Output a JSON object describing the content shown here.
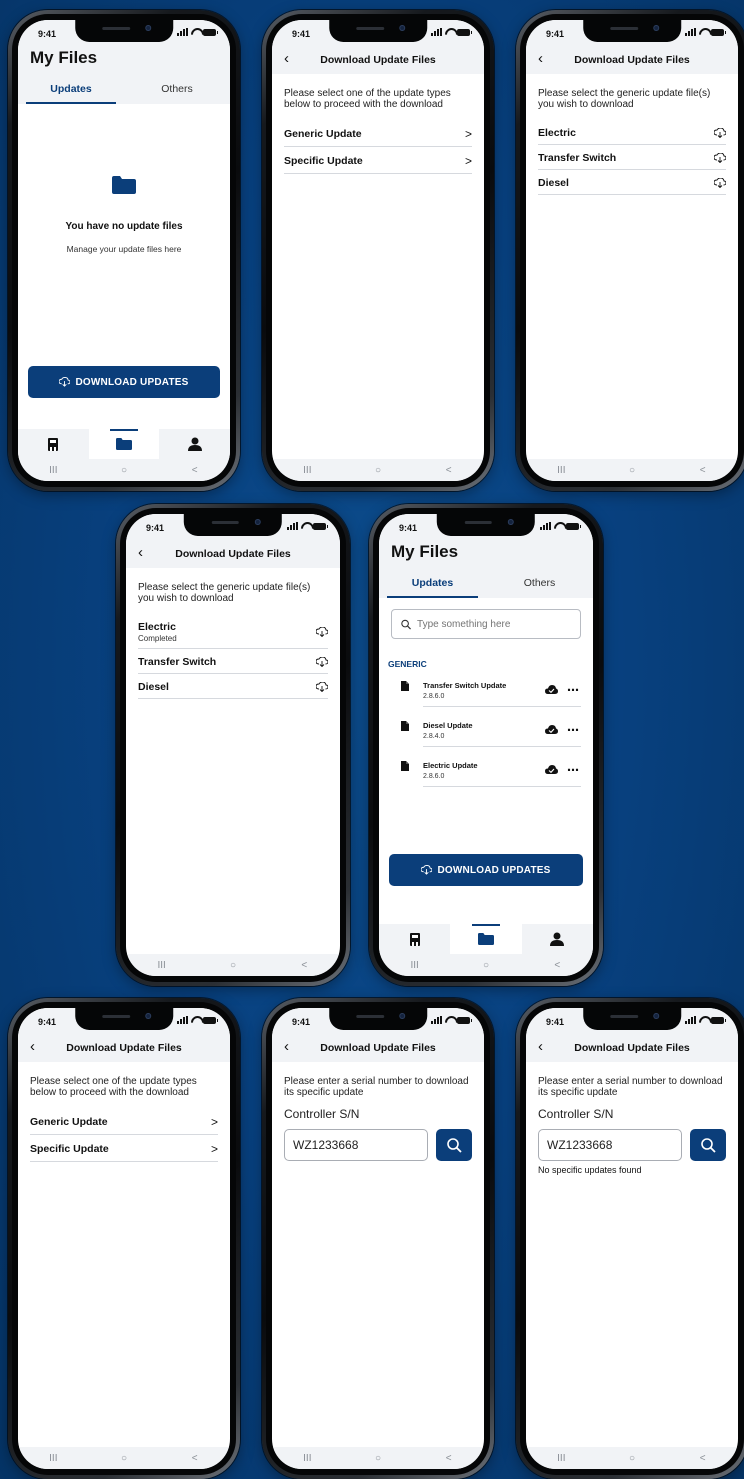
{
  "status": {
    "time": "9:41"
  },
  "system_nav": {
    "recent": "III",
    "home": "○",
    "back": "<"
  },
  "my_files": {
    "title": "My Files",
    "tabs": [
      {
        "label": "Updates"
      },
      {
        "label": "Others"
      }
    ],
    "empty_title": "You have no update files",
    "empty_subtitle": "Manage your update files here",
    "download_button": "DOWNLOAD UPDATES"
  },
  "download_page": {
    "title": "Download Update Files",
    "select_type_intro": "Please select one of the update types below to proceed with the download",
    "types": [
      {
        "label": "Generic Update"
      },
      {
        "label": "Specific Update"
      }
    ],
    "generic_intro": "Please select the generic update file(s) you wish to download",
    "generic_items": [
      {
        "label": "Electric",
        "status": "Completed"
      },
      {
        "label": "Transfer Switch"
      },
      {
        "label": "Diesel"
      }
    ]
  },
  "my_files_list": {
    "search_placeholder": "Type something here",
    "section": "GENERIC",
    "files": [
      {
        "name": "Transfer Switch Update",
        "version": "2.8.6.0"
      },
      {
        "name": "Diesel Update",
        "version": "2.8.4.0"
      },
      {
        "name": "Electric Update",
        "version": "2.8.6.0"
      }
    ]
  },
  "specific_page": {
    "intro": "Please enter a serial number to download its specific update",
    "field_label": "Controller S/N",
    "serial_value": "WZ1233668",
    "not_found": "No specific updates found"
  },
  "colors": {
    "background": "#084180",
    "accent": "#0b3e7a",
    "header": "#f1f3f6"
  },
  "icons": [
    "back-arrow-icon",
    "chevron-right-icon",
    "cloud-download-icon",
    "folder-icon",
    "generator-icon",
    "user-icon",
    "search-icon",
    "file-icon",
    "cloud-check-icon",
    "more-icon"
  ]
}
